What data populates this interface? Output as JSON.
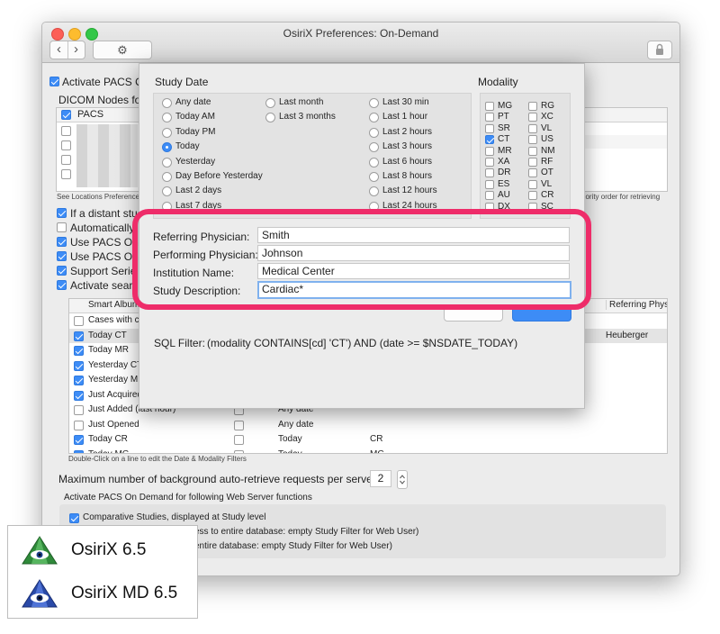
{
  "window": {
    "title": "OsiriX Preferences: On-Demand"
  },
  "toolbar": {
    "back": "‹",
    "forward": "›",
    "gear": "⚙"
  },
  "prefs": {
    "activate_pacs": "Activate PACS O",
    "dicom_nodes_label": "DICOM Nodes fo",
    "pacs_header": "PACS",
    "locations_note": "See Locations Preference",
    "priority_note": "riority order for retrieving",
    "options": [
      {
        "label": "If a distant stud",
        "checked": true
      },
      {
        "label": "Automatically",
        "checked": false
      },
      {
        "label": "Use PACS On",
        "checked": true
      },
      {
        "label": "Use PACS On",
        "checked": true
      },
      {
        "label": "Support Serie",
        "checked": true
      },
      {
        "label": "Activate searc",
        "checked": true
      }
    ],
    "albums_header": "Smart Album",
    "referring_header": "Referring Physi",
    "albums": [
      {
        "name": "Cases with c",
        "checked": false,
        "date": "",
        "modality": "",
        "extra": ""
      },
      {
        "name": "Today CT",
        "checked": true,
        "date": "",
        "modality": "",
        "extra": "Heuberger"
      },
      {
        "name": "Today MR",
        "checked": true,
        "date": "",
        "modality": "",
        "extra": ""
      },
      {
        "name": "Yesterday CT",
        "checked": true,
        "date": "",
        "modality": "",
        "extra": ""
      },
      {
        "name": "Yesterday MR",
        "checked": true,
        "date": "",
        "modality": "",
        "extra": ""
      },
      {
        "name": "Just Acquired",
        "checked": true,
        "date": "",
        "modality": "",
        "extra": ""
      },
      {
        "name": "Just Added (last hour)",
        "checked": false,
        "date": "Any date",
        "modality": "",
        "extra": ""
      },
      {
        "name": "Just Opened",
        "checked": false,
        "date": "Any date",
        "modality": "",
        "extra": ""
      },
      {
        "name": "Today CR",
        "checked": true,
        "date": "Today",
        "modality": "CR",
        "extra": ""
      },
      {
        "name": "Today MG",
        "checked": true,
        "date": "Today",
        "modality": "MG",
        "extra": ""
      }
    ],
    "double_click_note": "Double-Click on a line to edit the Date & Modality Filters",
    "max_requests_label": "Maximum number of background auto-retrieve requests per server:",
    "max_requests_value": "2",
    "web_functions_label": "Activate PACS On Demand for following Web Server functions",
    "web_items": [
      {
        "label": "Comparative Studies, displayed at Study level",
        "checked": true
      },
      {
        "label": "ess to entire database: empty Study Filter for Web User)",
        "checked": false
      },
      {
        "label": "entire database: empty Study Filter for Web User)",
        "checked": false
      }
    ]
  },
  "study_date": {
    "title": "Study Date",
    "col1": [
      "Any date",
      "Today AM",
      "Today PM",
      "Today",
      "Yesterday",
      "Day Before Yesterday",
      "Last 2 days",
      "Last 7 days"
    ],
    "col2": [
      "Last month",
      "Last 3 months"
    ],
    "col3": [
      "Last 30 min",
      "Last 1 hour",
      "Last 2 hours",
      "Last 3 hours",
      "Last 6 hours",
      "Last 8 hours",
      "Last 12 hours",
      "Last 24 hours"
    ],
    "selected": "Today"
  },
  "modality": {
    "title": "Modality",
    "col1": [
      {
        "code": "MG",
        "on": false
      },
      {
        "code": "PT",
        "on": false
      },
      {
        "code": "SR",
        "on": false
      },
      {
        "code": "CT",
        "on": true
      },
      {
        "code": "MR",
        "on": false
      },
      {
        "code": "XA",
        "on": false
      },
      {
        "code": "DR",
        "on": false
      },
      {
        "code": "ES",
        "on": false
      },
      {
        "code": "AU",
        "on": false
      },
      {
        "code": "DX",
        "on": false
      }
    ],
    "col2": [
      {
        "code": "RG",
        "on": false
      },
      {
        "code": "XC",
        "on": false
      },
      {
        "code": "VL",
        "on": false
      },
      {
        "code": "US",
        "on": false
      },
      {
        "code": "NM",
        "on": false
      },
      {
        "code": "RF",
        "on": false
      },
      {
        "code": "OT",
        "on": false
      },
      {
        "code": "VL",
        "on": false
      },
      {
        "code": "CR",
        "on": false
      },
      {
        "code": "SC",
        "on": false
      }
    ]
  },
  "filters": {
    "referring_label": "Referring Physician:",
    "referring_value": "Smith",
    "performing_label": "Performing Physician:",
    "performing_value": "Johnson",
    "institution_label": "Institution Name:",
    "institution_value": "Medical Center",
    "description_label": "Study Description:",
    "description_value": "Cardiac*"
  },
  "sql": {
    "label": "SQL Filter:",
    "value": "(modality CONTAINS[cd] 'CT') AND (date >= $NSDATE_TODAY)"
  },
  "badges": [
    {
      "label": "OsiriX 6.5"
    },
    {
      "label": "OsiriX MD 6.5"
    }
  ],
  "colors": {
    "highlight": "#ee2c69",
    "accent": "#3d8cf6"
  }
}
